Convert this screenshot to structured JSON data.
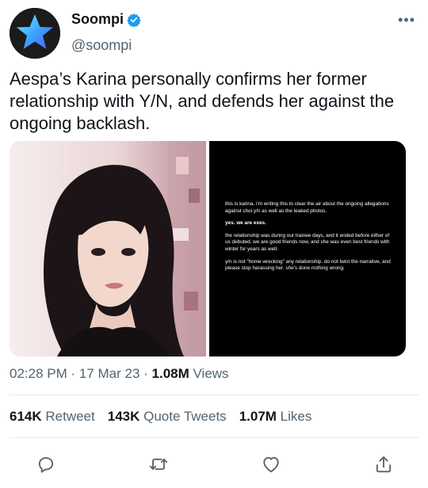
{
  "account": {
    "display_name": "Soompi",
    "handle": "@soompi",
    "avatar_icon": "blue-star-logo",
    "verified_icon": "verified-badge-icon",
    "more_icon": "more-options-icon",
    "more_label": "•••"
  },
  "tweet": {
    "text": "Aespa’s Karina personally confirms her former relationship with Y/N, and defends her against the ongoing backlash."
  },
  "media": {
    "photo_icon": "portrait-photo",
    "statement": {
      "p1": "this is karina. i'm writing this to clear the air about the ongoing allegations against choi y/n as well as the leaked photos.",
      "p2": "yes. we are exes.",
      "p3": "the relationship was during our trainee days, and it ended before either of us debuted. we are good friends now, and she was even best friends with winter for years as well.",
      "p4": "y/n is not \"home wrecking\" any relationship. do not twist the narrative, and please stop harassing her. she's done nothing wrong."
    }
  },
  "meta": {
    "time": "02:28 PM",
    "sep1": " · ",
    "date": "17 Mar 23",
    "sep2": " · ",
    "views_count": "1.08M",
    "views_label": " Views"
  },
  "stats": {
    "retweets_count": "614K",
    "retweets_label": " Retweet",
    "quotes_count": "143K",
    "quotes_label": " Quote Tweets",
    "likes_count": "1.07M",
    "likes_label": " Likes"
  },
  "actions": {
    "reply_icon": "reply-icon",
    "retweet_icon": "retweet-icon",
    "like_icon": "like-icon",
    "share_icon": "share-icon"
  },
  "colors": {
    "brand_blue": "#1d9bf0",
    "text": "#0f1419",
    "muted": "#536471",
    "divider": "#e6ebee"
  }
}
